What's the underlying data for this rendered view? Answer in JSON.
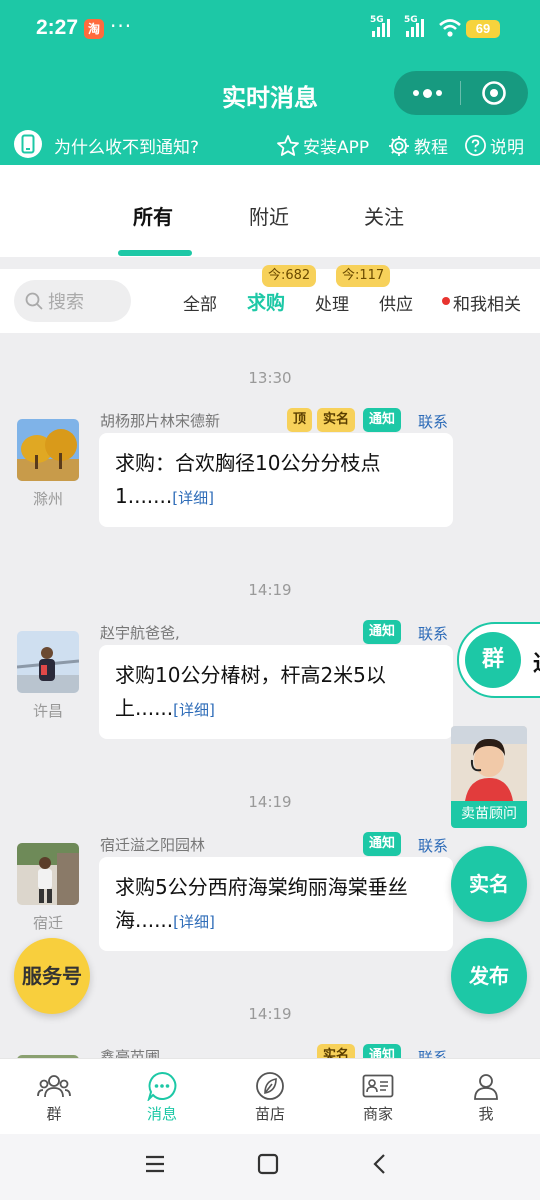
{
  "status_bar": {
    "time": "2:27",
    "app_badge": "淘",
    "more_dots": "···",
    "net1": "5G",
    "net2": "5G",
    "battery": "69"
  },
  "header": {
    "title": "实时消息"
  },
  "notice": {
    "text": "为什么收不到通知?",
    "install_app": "安装APP",
    "tutorial": "教程",
    "explain": "说明"
  },
  "main_tabs": [
    {
      "label": "所有"
    },
    {
      "label": "附近"
    },
    {
      "label": "关注"
    }
  ],
  "filters": {
    "search_placeholder": "搜索",
    "items": [
      {
        "label": "全部"
      },
      {
        "label": "求购",
        "badge": "今:682"
      },
      {
        "label": "处理",
        "badge": "今:117"
      },
      {
        "label": "供应"
      },
      {
        "label": "和我相关"
      }
    ]
  },
  "messages": [
    {
      "time": "13:30",
      "name": "胡杨那片林宋德新",
      "location": "滁州",
      "tags": [
        "顶",
        "实名",
        "通知"
      ],
      "contact": "联系",
      "text": "求购：合欢胸径10公分分枝点1.......",
      "detail": "[详细]"
    },
    {
      "time": "14:19",
      "name": "赵宇航爸爸,",
      "location": "许昌",
      "tags": [
        "通知"
      ],
      "contact": "联系",
      "text": "求购10公分椿树，杆高2米5以上......",
      "detail": "[详细]"
    },
    {
      "time": "14:19",
      "name": "宿迁溢之阳园林",
      "location": "宿迁",
      "tags": [
        "通知"
      ],
      "contact": "联系",
      "text": "求购5公分西府海棠绚丽海棠垂丝海......",
      "detail": "[详细]"
    },
    {
      "time": "14:19",
      "name": "鑫豪苗圃",
      "location": "",
      "tags": [
        "实名",
        "通知"
      ],
      "contact": "联系",
      "text": "",
      "detail": ""
    }
  ],
  "floating": {
    "group": "群",
    "group_peek": "进",
    "advisor": "卖苗顾问",
    "realname": "实名",
    "publish": "发布",
    "service": "服务号"
  },
  "bottom_nav": [
    {
      "label": "群",
      "icon": "group-icon"
    },
    {
      "label": "消息",
      "icon": "message-icon"
    },
    {
      "label": "苗店",
      "icon": "leaf-icon"
    },
    {
      "label": "商家",
      "icon": "id-card-icon"
    },
    {
      "label": "我",
      "icon": "person-icon"
    }
  ],
  "colors": {
    "accent": "#1dc8a6",
    "badge": "#f7d15a",
    "link": "#2e6cb8"
  }
}
